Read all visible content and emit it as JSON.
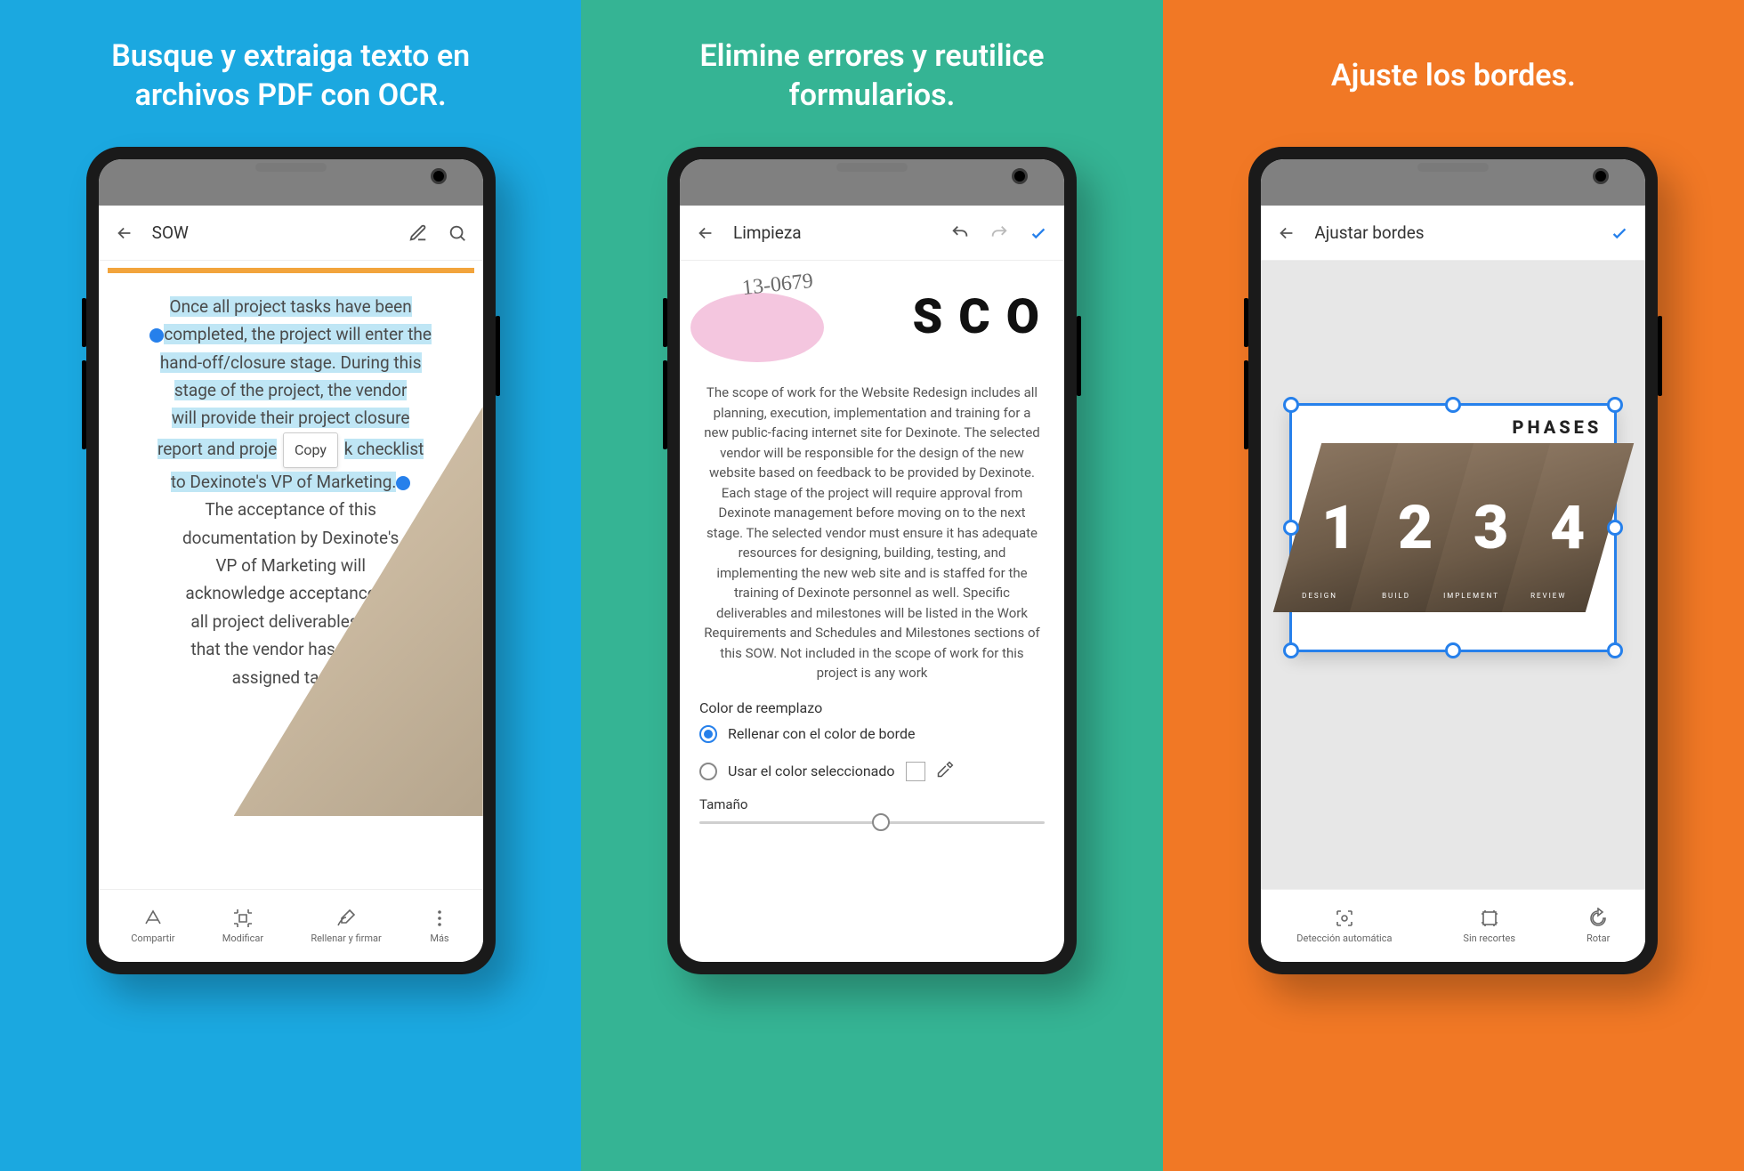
{
  "panels": {
    "p1": {
      "headline": "Busque y extraiga texto en archivos PDF con OCR.",
      "appbar_title": "SOW",
      "doc_text_highlighted": "Once all project tasks have been completed, the project will enter the hand-off/closure stage. During this stage of the project, the vendor will provide their project closure report and project task checklist to Dexinote's VP of Marketing.",
      "doc_line_hl_1": "Once all project tasks have been",
      "doc_line_hl_2": "completed, the project will enter the",
      "doc_line_hl_3": "hand-off/closure stage. During this",
      "doc_line_hl_4": "stage of the project, the vendor",
      "doc_line_hl_5": "will provide their project closure",
      "doc_line_hl_6a": "report and proje",
      "doc_line_hl_6b": "k checklist",
      "doc_line_hl_7": "to Dexinote's VP of Marketing.",
      "copy_label": "Copy",
      "doc_rest_1": "The acceptance of this",
      "doc_rest_2": "documentation by Dexinote's",
      "doc_rest_3": "VP of Marketing will",
      "doc_rest_4": "acknowledge acceptance of",
      "doc_rest_5": "all project deliverables and",
      "doc_rest_6": "that the vendor has met all",
      "doc_rest_7": "assigned tasks.",
      "bottom": {
        "share": "Compartir",
        "modify": "Modificar",
        "fill_sign": "Rellenar y firmar",
        "more": "Más"
      }
    },
    "p2": {
      "headline": "Elimine errores y reutilice formularios.",
      "appbar_title": "Limpieza",
      "handwritten": "13-0679",
      "big_title": "SCO",
      "body": "The scope of work for the Website Redesign includes all planning, execution, implementation and training for a new public-facing internet site for Dexinote. The selected vendor will be responsible for the design of the new website based on feedback to be provided by Dexinote. Each stage of the project will require approval from Dexinote management before moving on to the next stage. The selected vendor must ensure it has adequate resources for designing, building, testing, and implementing the new web site and is staffed for the training of Dexinote personnel as well. Specific deliverables and milestones will be listed in the Work Requirements and Schedules and Milestones sections of this SOW. Not included in the scope of work for this project is any work",
      "replace_color_label": "Color de reemplazo",
      "radio_fill_border": "Rellenar con el color de borde",
      "radio_use_selected": "Usar el color seleccionado",
      "size_label": "Tamaño"
    },
    "p3": {
      "headline": "Ajuste los bordes.",
      "appbar_title": "Ajustar bordes",
      "phases_title": "PHASES",
      "phase_nums": [
        "1",
        "2",
        "3",
        "4"
      ],
      "phase_labels": [
        "DESIGN",
        "BUILD",
        "IMPLEMENT",
        "REVIEW"
      ],
      "bottom": {
        "auto_detect": "Detección automática",
        "no_crop": "Sin recortes",
        "rotate": "Rotar"
      }
    }
  },
  "colors": {
    "blue": "#1ba8e0",
    "green": "#35b494",
    "orange": "#f17825",
    "accent_blue": "#2680eb"
  }
}
